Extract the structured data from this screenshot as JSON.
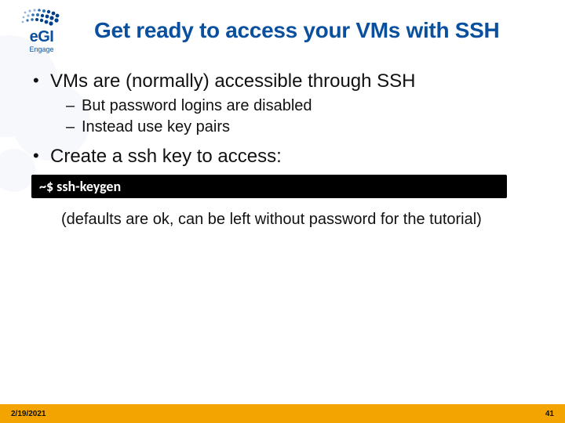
{
  "logo": {
    "text": "eGI",
    "subtext": "Engage"
  },
  "title": "Get ready to access your VMs with SSH",
  "bullets": {
    "b1": "VMs are (normally) accessible through SSH",
    "b1_sub1": "But password logins are disabled",
    "b1_sub2": "Instead use key pairs",
    "b2": "Create a ssh key to access:"
  },
  "terminal": "~$ ssh-keygen",
  "note": "(defaults are ok, can be left without password for the tutorial)",
  "footer": {
    "date": "2/19/2021",
    "page": "41"
  }
}
